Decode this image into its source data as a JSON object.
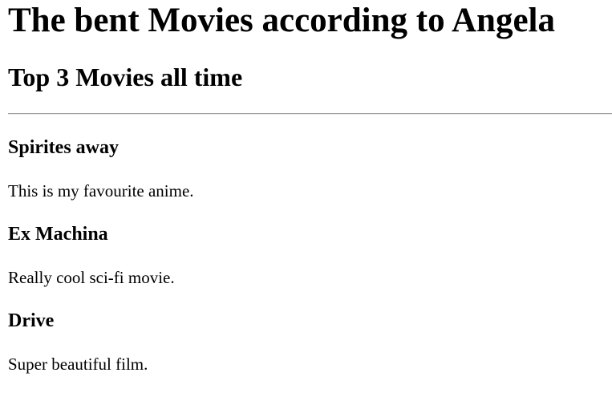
{
  "page": {
    "title": "The bent Movies according to Angela",
    "subtitle": "Top 3 Movies all time"
  },
  "movies": [
    {
      "title": "Spirites away",
      "description": "This is my favourite anime."
    },
    {
      "title": "Ex Machina",
      "description": "Really cool sci-fi movie."
    },
    {
      "title": "Drive",
      "description": "Super beautiful film."
    }
  ]
}
